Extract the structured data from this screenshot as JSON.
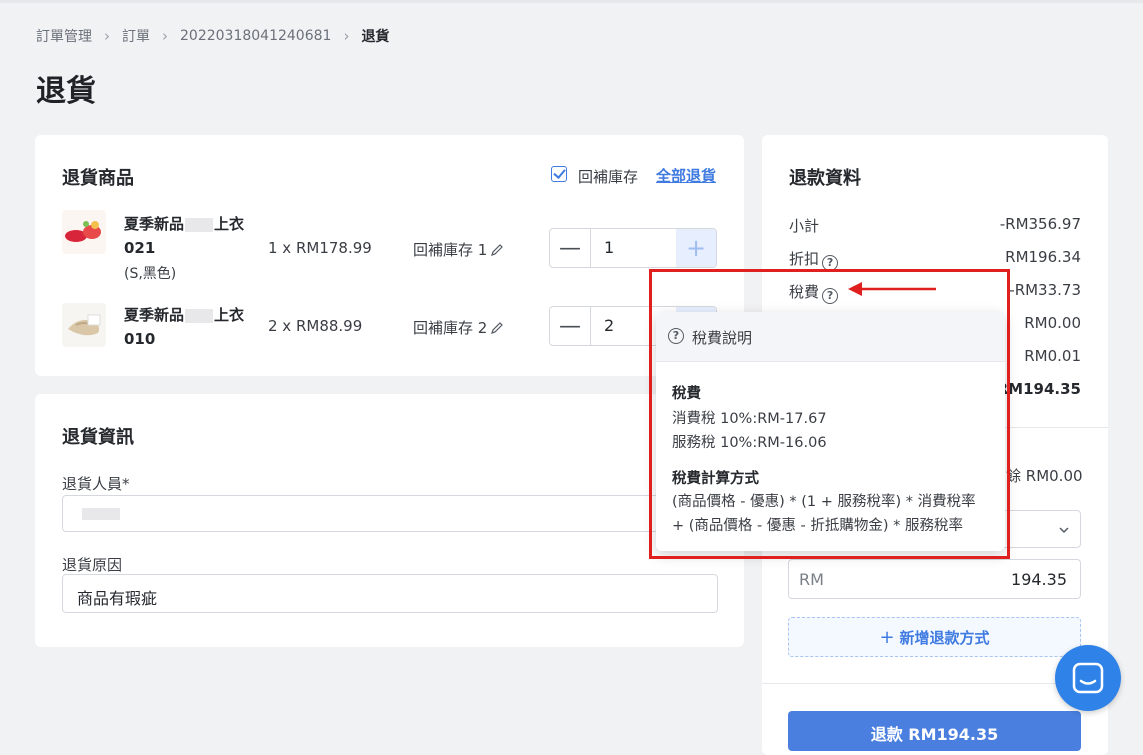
{
  "breadcrumb": [
    "訂單管理",
    "訂單",
    "20220318041240681",
    "退貨"
  ],
  "page_title": "退貨",
  "items_card": {
    "title": "退貨商品",
    "restock_label": "回補庫存",
    "return_all_label": "全部退貨",
    "items": [
      {
        "name_a": "夏季新品",
        "name_b": "上衣",
        "name_c": "021",
        "variant": "(S,黑色)",
        "qty_price": "1 x RM178.99",
        "restock_note": "回補庫存 1",
        "stepper_value": "1"
      },
      {
        "name_a": "夏季新品",
        "name_b": "上衣",
        "name_c": "010",
        "variant": "",
        "qty_price": "2 x RM88.99",
        "restock_note": "回補庫存 2",
        "stepper_value": "2"
      }
    ]
  },
  "info_card": {
    "title": "退貨資訊",
    "staff_label": "退貨人員*",
    "reason_label": "退貨原因",
    "reason_value": "商品有瑕疵"
  },
  "refund_card": {
    "title": "退款資料",
    "rows": [
      {
        "label": "小計",
        "value": "-RM356.97"
      },
      {
        "label": "折扣",
        "value": "RM196.34"
      },
      {
        "label": "稅費",
        "value": "-RM33.73"
      },
      {
        "label": "",
        "value": "RM0.00"
      },
      {
        "label": "",
        "value": "RM0.01"
      },
      {
        "label": "",
        "value": "-RM194.35"
      }
    ],
    "remaining_text": "餘 RM0.00",
    "amount_prefix": "RM",
    "amount_value": "194.35",
    "add_method_label": "新增退款方式",
    "refund_button_label": "退款 RM194.35"
  },
  "tax_popover": {
    "title": "稅費說明",
    "section1_title": "稅費",
    "line1": "消費稅 10%:RM-17.67",
    "line2": "服務稅 10%:RM-16.06",
    "section2_title": "稅費計算方式",
    "formula1": "(商品價格 - 優惠) * (1 + 服務稅率) * 消費稅率",
    "formula2": "+ (商品價格 - 優惠 - 折抵購物金) * 服務稅率"
  },
  "colors": {
    "accent": "#3f7be0",
    "highlight": "#e0201f",
    "chat": "#2f82e8"
  }
}
